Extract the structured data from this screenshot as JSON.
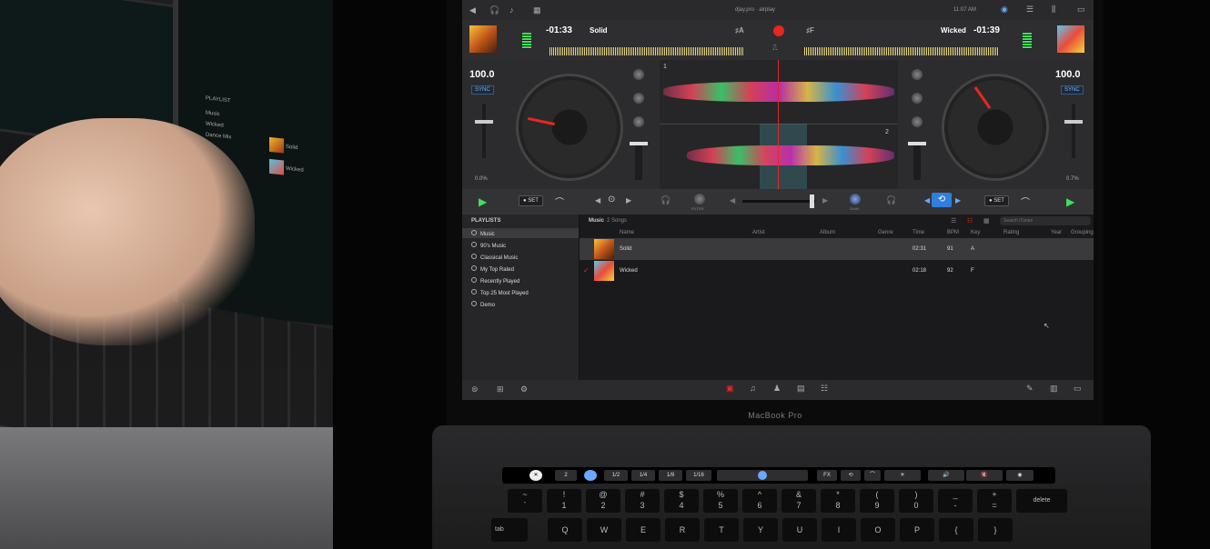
{
  "photo": {
    "playlist_label": "PLAYLIST",
    "items": [
      "Music",
      "Wicked",
      "Dance Mix"
    ],
    "thumb_labels": [
      "Solid",
      "Wicked"
    ]
  },
  "menubar": {
    "title": "djay.pro · airplay",
    "clock": "11:07 AM"
  },
  "deck_a": {
    "time": "-01:33",
    "track": "Solid",
    "key": "A",
    "bpm": "100.0",
    "sync": "SYNC",
    "pitch": "0.0%"
  },
  "deck_b": {
    "time": "-01:39",
    "track": "Wicked",
    "key": "F",
    "bpm": "100.0",
    "sync": "SYNC",
    "pitch": "0.7%"
  },
  "wave": {
    "deck_a_index": "1",
    "deck_b_index": "2"
  },
  "transport": {
    "set_label": "SET",
    "filter_label": "FILTER",
    "gain_label": "GAIN"
  },
  "browser": {
    "playlists_title": "PLAYLISTS",
    "playlists": [
      "Music",
      "90's Music",
      "Classical Music",
      "My Top Rated",
      "Recently Played",
      "Top 25 Most Played",
      "Demo"
    ],
    "crumb": "Music",
    "crumb_count": "2 Songs",
    "search_placeholder": "Search iTunes",
    "columns": [
      "Name",
      "Artist",
      "Album",
      "Genre",
      "Time",
      "BPM",
      "Key",
      "Rating",
      "Year",
      "Grouping"
    ],
    "rows": [
      {
        "name": "Solid",
        "time": "02:31",
        "bpm": "91",
        "key": "A"
      },
      {
        "name": "Wicked",
        "time": "02:18",
        "bpm": "92",
        "key": "F"
      }
    ]
  },
  "laptop": {
    "label": "MacBook Pro"
  },
  "touchbar": {
    "loop_values": [
      "2",
      "1/2",
      "1/4",
      "1/8",
      "1/16"
    ],
    "fx_label": "FX"
  },
  "keyboard": {
    "top": [
      "~",
      "!",
      "@",
      "#",
      "$",
      "%",
      "^",
      "&",
      "*",
      "(",
      ")",
      "_",
      "+"
    ],
    "bottom": [
      "`",
      "1",
      "2",
      "3",
      "4",
      "5",
      "6",
      "7",
      "8",
      "9",
      "0",
      "-",
      "="
    ],
    "delete_label": "delete",
    "letters": [
      "Q",
      "W",
      "E",
      "R",
      "T",
      "Y",
      "U",
      "I",
      "O",
      "P",
      "{",
      "}"
    ],
    "tab_label": "tab"
  }
}
